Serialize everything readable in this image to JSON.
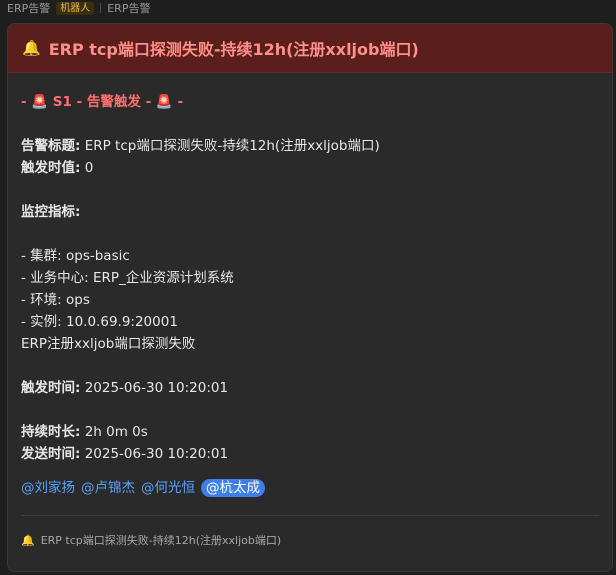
{
  "topbar": {
    "chat_name": "ERP告警",
    "bot_badge": "机器人",
    "source_name": "ERP告警"
  },
  "card": {
    "header_icon": "bell-icon",
    "title": "ERP tcp端口探测失败-持续12h(注册xxljob端口)",
    "severity_line": "- 🚨 S1 - 告警触发 - 🚨 -",
    "alert_title_label": "告警标题:",
    "alert_title_value": " ERP tcp端口探测失败-持续12h(注册xxljob端口)",
    "threshold_label": " 触发时值:",
    "threshold_value": " 0",
    "metrics_label": "监控指标:",
    "metrics": [
      "- 集群: ops-basic",
      "- 业务中心: ERP_企业资源计划系统",
      "- 环境: ops",
      "- 实例: 10.0.69.9:20001"
    ],
    "metric_desc": "ERP注册xxljob端口探测失败",
    "trigger_time_label": "触发时间:",
    "trigger_time_value": " 2025-06-30 10:20:01",
    "duration_label": "持续时长:",
    "duration_value": " 2h 0m 0s",
    "send_time_label": "发送时间:",
    "send_time_value": " 2025-06-30 10:20:01",
    "mentions": [
      "@刘家扬",
      "@卢锦杰",
      "@何光恒"
    ],
    "self_mention": "@杭太成",
    "footer_text": "ERP tcp端口探测失败-持续12h(注册xxljob端口)"
  },
  "colors": {
    "header_bg": "#5a1f1c",
    "title": "#ff8f87",
    "severity": "#ff6f6f",
    "mention": "#5aa2ff",
    "self_mention_bg": "#3d7ee8"
  }
}
